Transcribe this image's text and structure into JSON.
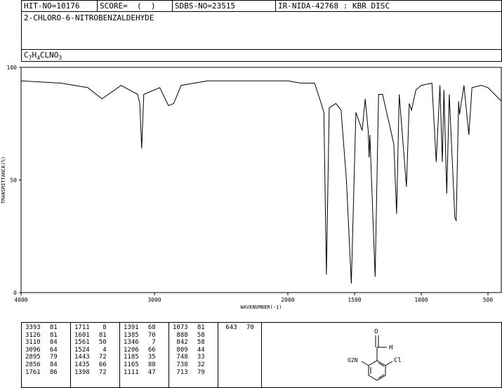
{
  "header": {
    "hit_no": "HIT-NO=10176",
    "score": "SCORE=  (  )",
    "sdbs_no": "SDBS-NO=23515",
    "ir_nida": "IR-NIDA-42768 : KBR DISC"
  },
  "compound_name": "2-CHLORO-6-NITROBENZALDEHYDE",
  "formula": {
    "parts": [
      {
        "t": "C",
        "sub": false
      },
      {
        "t": "7",
        "sub": true
      },
      {
        "t": "H",
        "sub": false
      },
      {
        "t": "4",
        "sub": true
      },
      {
        "t": "CLNO",
        "sub": false
      },
      {
        "t": "3",
        "sub": true
      }
    ]
  },
  "chart_data": {
    "type": "line",
    "xlabel": "WAVENUMBER(-1)",
    "ylabel": "TRANSMITTANCE(%)",
    "xlim": [
      4000,
      400
    ],
    "ylim": [
      0,
      100
    ],
    "x_ticks": [
      4000,
      3000,
      2000,
      1500,
      1000,
      500
    ],
    "y_ticks": [
      0,
      50,
      100
    ],
    "grid": false,
    "baseline": [
      [
        4000,
        94
      ],
      [
        3700,
        93
      ],
      [
        3500,
        91
      ],
      [
        3393,
        86
      ],
      [
        3250,
        92
      ],
      [
        3126,
        88
      ],
      [
        3110,
        84
      ],
      [
        3096,
        64
      ],
      [
        3080,
        88
      ],
      [
        2960,
        91
      ],
      [
        2895,
        83
      ],
      [
        2856,
        84
      ],
      [
        2800,
        92
      ],
      [
        2600,
        94
      ],
      [
        2300,
        94
      ],
      [
        2000,
        94
      ],
      [
        1900,
        93
      ],
      [
        1800,
        93
      ],
      [
        1761,
        86
      ],
      [
        1730,
        80
      ],
      [
        1711,
        8
      ],
      [
        1690,
        82
      ],
      [
        1640,
        84
      ],
      [
        1601,
        81
      ],
      [
        1561,
        50
      ],
      [
        1524,
        4
      ],
      [
        1490,
        80
      ],
      [
        1443,
        72
      ],
      [
        1420,
        86
      ],
      [
        1398,
        72
      ],
      [
        1391,
        60
      ],
      [
        1385,
        70
      ],
      [
        1346,
        7
      ],
      [
        1320,
        88
      ],
      [
        1290,
        88
      ],
      [
        1206,
        66
      ],
      [
        1185,
        35
      ],
      [
        1165,
        88
      ],
      [
        1111,
        47
      ],
      [
        1090,
        84
      ],
      [
        1073,
        81
      ],
      [
        1040,
        90
      ],
      [
        1000,
        92
      ],
      [
        920,
        93
      ],
      [
        888,
        58
      ],
      [
        860,
        92
      ],
      [
        842,
        58
      ],
      [
        830,
        90
      ],
      [
        809,
        44
      ],
      [
        790,
        88
      ],
      [
        748,
        33
      ],
      [
        738,
        32
      ],
      [
        720,
        85
      ],
      [
        713,
        79
      ],
      [
        680,
        92
      ],
      [
        643,
        70
      ],
      [
        620,
        91
      ],
      [
        550,
        92
      ],
      [
        500,
        91
      ],
      [
        450,
        88
      ],
      [
        400,
        85
      ]
    ]
  },
  "peak_table": [
    {
      "w": "3393",
      "t": "81"
    },
    {
      "w": "3126",
      "t": "81"
    },
    {
      "w": "3110",
      "t": "84"
    },
    {
      "w": "3096",
      "t": "64"
    },
    {
      "w": "2895",
      "t": "79"
    },
    {
      "w": "2856",
      "t": "84"
    },
    {
      "w": "1761",
      "t": "86"
    },
    {
      "w": "1711",
      "t": "8"
    },
    {
      "w": "1601",
      "t": "81"
    },
    {
      "w": "1561",
      "t": "50"
    },
    {
      "w": "1524",
      "t": "4"
    },
    {
      "w": "1443",
      "t": "72"
    },
    {
      "w": "1435",
      "t": "66"
    },
    {
      "w": "1398",
      "t": "72"
    },
    {
      "w": "1391",
      "t": "68"
    },
    {
      "w": "1385",
      "t": "70"
    },
    {
      "w": "1346",
      "t": "7"
    },
    {
      "w": "1206",
      "t": "66"
    },
    {
      "w": "1185",
      "t": "35"
    },
    {
      "w": "1165",
      "t": "88"
    },
    {
      "w": "1111",
      "t": "47"
    },
    {
      "w": "1073",
      "t": "81"
    },
    {
      "w": "888",
      "t": "58"
    },
    {
      "w": "842",
      "t": "58"
    },
    {
      "w": "809",
      "t": "44"
    },
    {
      "w": "748",
      "t": "33"
    },
    {
      "w": "738",
      "t": "32"
    },
    {
      "w": "713",
      "t": "79"
    },
    {
      "w": "643",
      "t": "70"
    }
  ],
  "structure_labels": {
    "oxygen": "O",
    "hydrogen": "H",
    "nitro": "O2N",
    "chloro": "Cl"
  }
}
